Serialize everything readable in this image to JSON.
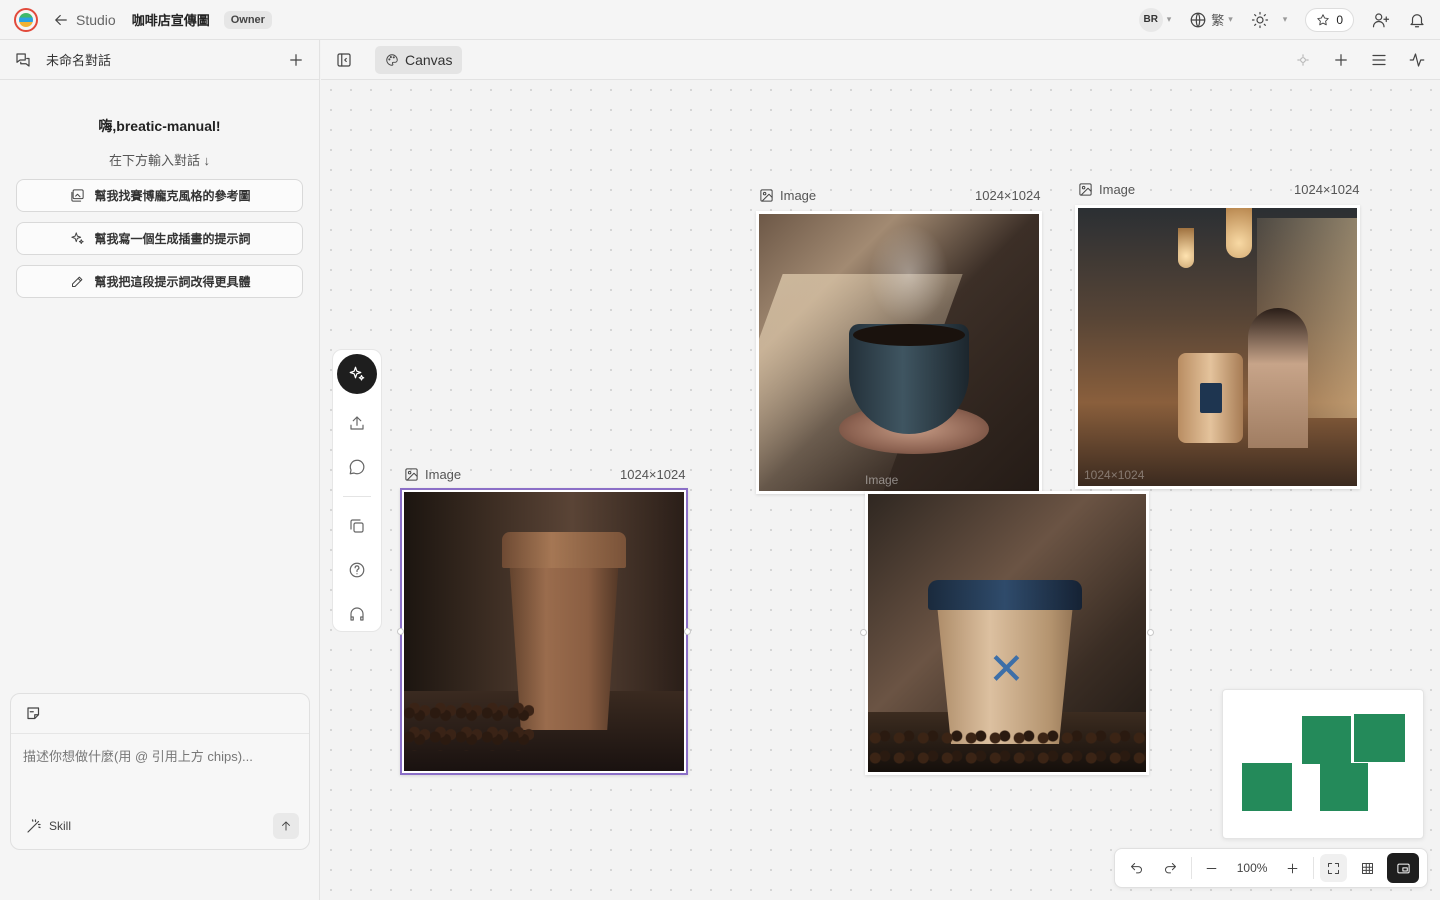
{
  "topbar": {
    "back_label": "Studio",
    "project_name": "咖啡店宣傳圖",
    "role_badge": "Owner",
    "avatar_initials": "BR",
    "language": "繁",
    "star_count": "0"
  },
  "left_panel": {
    "conversation_title": "未命名對話",
    "greeting": "嗨,breatic-manual!",
    "greeting_sub": "在下方輸入對話 ↓",
    "suggestions": [
      {
        "label": "幫我找賽博龐克風格的參考圖",
        "icon": "image-search-icon"
      },
      {
        "label": "幫我寫一個生成插畫的提示詞",
        "icon": "sparkles-icon"
      },
      {
        "label": "幫我把這段提示詞改得更具體",
        "icon": "pencil-icon"
      }
    ],
    "composer": {
      "placeholder": "描述你想做什麼(用 @ 引用上方 chips)...",
      "skill_label": "Skill"
    }
  },
  "canvas_header": {
    "tab_label": "Canvas"
  },
  "canvas": {
    "nodes": [
      {
        "label": "Image",
        "size": "1024×1024",
        "description": "brown paper coffee cup on wooden table with beans",
        "selected": true
      },
      {
        "label": "Image",
        "size": "1024×1024",
        "description": "steaming blue ceramic coffee cup on saucer"
      },
      {
        "label": "Image",
        "size": "1024×1024",
        "description": "cafe interior with pendant lamps and appliance"
      }
    ],
    "untitled_nodes": [
      {
        "description": "paper coffee cup with blue lid on table with beans"
      }
    ],
    "watermarks": {
      "p2": "Image",
      "p3": "1024×1024"
    }
  },
  "zoom": {
    "level": "100%"
  },
  "colors": {
    "accent_selected": "#8b6fc7",
    "minimap_blocks": "#248a5a",
    "logo_ring": "#e24a3b"
  }
}
